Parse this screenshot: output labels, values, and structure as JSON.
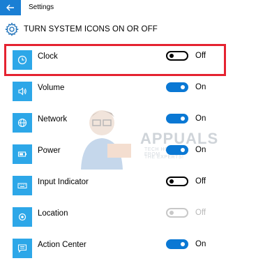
{
  "window": {
    "title": "Settings"
  },
  "header": {
    "title": "TURN SYSTEM ICONS ON OR OFF",
    "icon": "gear-icon"
  },
  "settings": [
    {
      "label": "Clock",
      "state": "Off",
      "enabled": true,
      "icon": "clock-icon"
    },
    {
      "label": "Volume",
      "state": "On",
      "enabled": true,
      "icon": "volume-icon"
    },
    {
      "label": "Network",
      "state": "On",
      "enabled": true,
      "icon": "network-icon"
    },
    {
      "label": "Power",
      "state": "On",
      "enabled": true,
      "icon": "battery-icon"
    },
    {
      "label": "Input Indicator",
      "state": "Off",
      "enabled": true,
      "icon": "keyboard-icon"
    },
    {
      "label": "Location",
      "state": "Off",
      "enabled": false,
      "icon": "location-icon"
    },
    {
      "label": "Action Center",
      "state": "On",
      "enabled": true,
      "icon": "action-center-icon"
    }
  ],
  "watermark": {
    "title": "APPUALS",
    "line1": "TECH HOW-TO'S FROM",
    "line2": "THE EXPERTS!"
  },
  "colors": {
    "accent": "#0a78d4",
    "tile": "#2da7e8",
    "highlight": "#e52230"
  }
}
